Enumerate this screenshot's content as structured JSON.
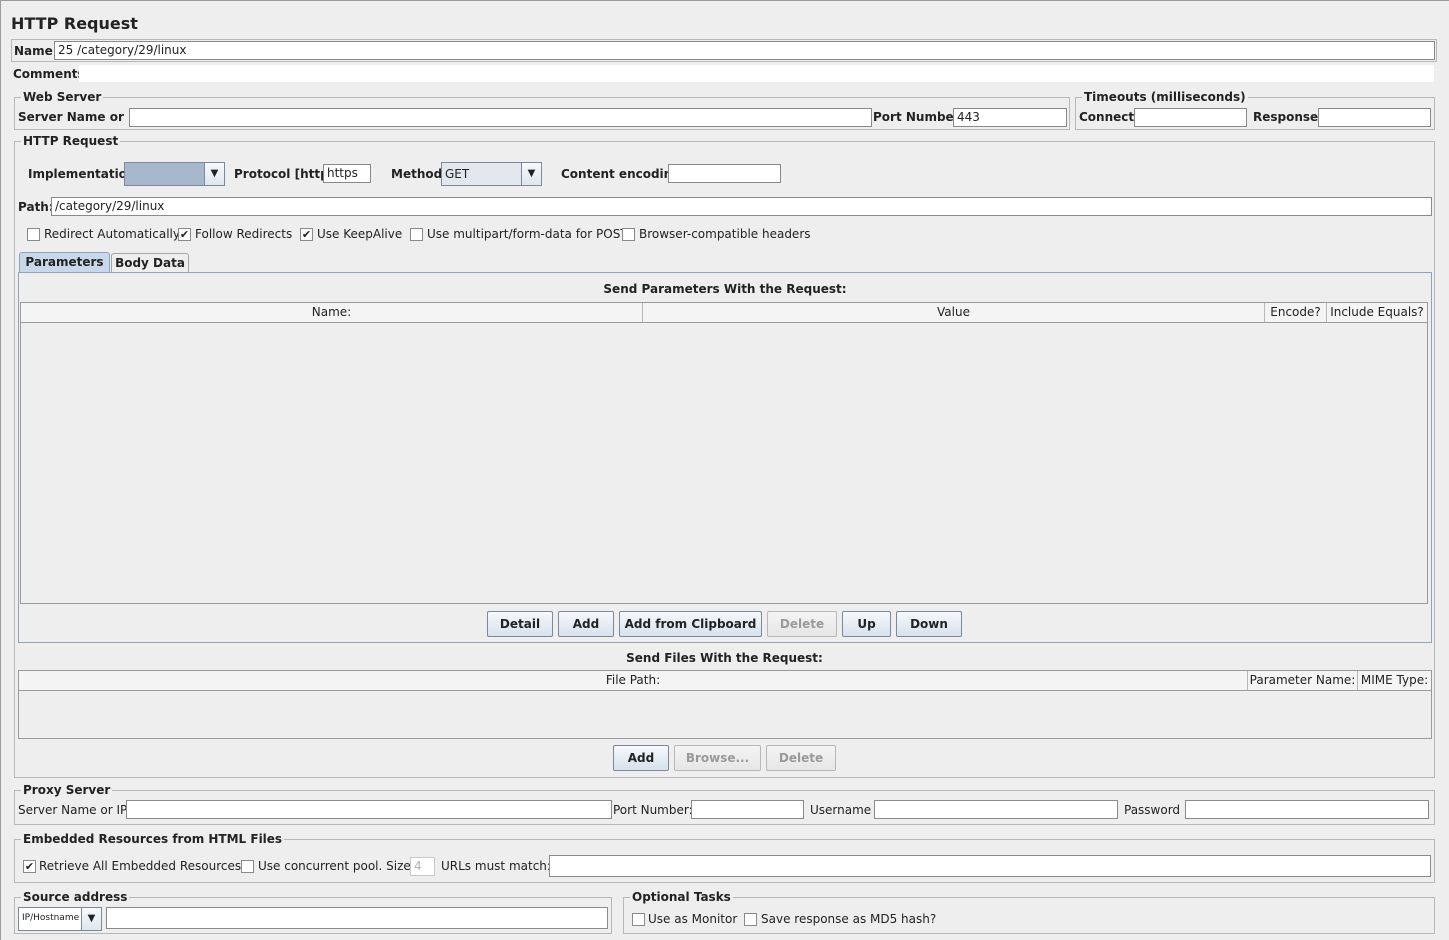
{
  "title": "HTTP Request",
  "name_row": {
    "label": "Name:",
    "value": "25 /category/29/linux"
  },
  "comments_row": {
    "label": "Comments:",
    "value": ""
  },
  "web_server": {
    "title": "Web Server",
    "server_label": "Server Name or IP:",
    "server_value": "",
    "port_label": "Port Number:",
    "port_value": "443"
  },
  "timeouts": {
    "title": "Timeouts (milliseconds)",
    "connect_label": "Connect:",
    "connect_value": "",
    "response_label": "Response:",
    "response_value": ""
  },
  "http_request": {
    "title": "HTTP Request",
    "implementation_label": "Implementation:",
    "implementation_value": "",
    "protocol_label": "Protocol [http]:",
    "protocol_value": "https",
    "method_label": "Method:",
    "method_value": "GET",
    "encoding_label": "Content encoding:",
    "encoding_value": "",
    "path_label": "Path:",
    "path_value": "/category/29/linux",
    "options": [
      {
        "label": "Redirect Automatically",
        "checked": false
      },
      {
        "label": "Follow Redirects",
        "checked": true
      },
      {
        "label": "Use KeepAlive",
        "checked": true
      },
      {
        "label": "Use multipart/form-data for POST",
        "checked": false
      },
      {
        "label": "Browser-compatible headers",
        "checked": false
      }
    ]
  },
  "tabs": [
    {
      "label": "Parameters",
      "active": true
    },
    {
      "label": "Body Data",
      "active": false
    }
  ],
  "params": {
    "title": "Send Parameters With the Request:",
    "columns": [
      "Name:",
      "Value",
      "Encode?",
      "Include Equals?"
    ],
    "buttons": [
      {
        "label": "Detail",
        "enabled": true
      },
      {
        "label": "Add",
        "enabled": true
      },
      {
        "label": "Add from Clipboard",
        "enabled": true
      },
      {
        "label": "Delete",
        "enabled": false
      },
      {
        "label": "Up",
        "enabled": true
      },
      {
        "label": "Down",
        "enabled": true
      }
    ]
  },
  "files": {
    "title": "Send Files With the Request:",
    "columns": [
      "File Path:",
      "Parameter Name:",
      "MIME Type:"
    ],
    "buttons": [
      {
        "label": "Add",
        "enabled": true
      },
      {
        "label": "Browse...",
        "enabled": false
      },
      {
        "label": "Delete",
        "enabled": false
      }
    ]
  },
  "proxy": {
    "title": "Proxy Server",
    "server_label": "Server Name or IP:",
    "port_label": "Port Number:",
    "username_label": "Username",
    "password_label": "Password",
    "server_value": "",
    "port_value": "",
    "username_value": "",
    "password_value": ""
  },
  "embedded": {
    "title": "Embedded Resources from HTML Files",
    "retrieve_label": "Retrieve All Embedded Resources",
    "retrieve_checked": true,
    "concurrent_label": "Use concurrent pool. Size:",
    "concurrent_checked": false,
    "pool_size": "4",
    "urls_label": "URLs must match:",
    "urls_value": ""
  },
  "source": {
    "title": "Source address",
    "type_value": "IP/Hostname",
    "address_value": ""
  },
  "optional": {
    "title": "Optional Tasks",
    "monitor_label": "Use as Monitor",
    "monitor_checked": false,
    "md5_label": "Save response as MD5 hash?",
    "md5_checked": false
  },
  "colors": {
    "window_bg": "#eeeeee",
    "tab_panel_border": "#8da4be",
    "active_tab": "#c8d8ea",
    "implementation_combo": "#a8b8cc"
  }
}
